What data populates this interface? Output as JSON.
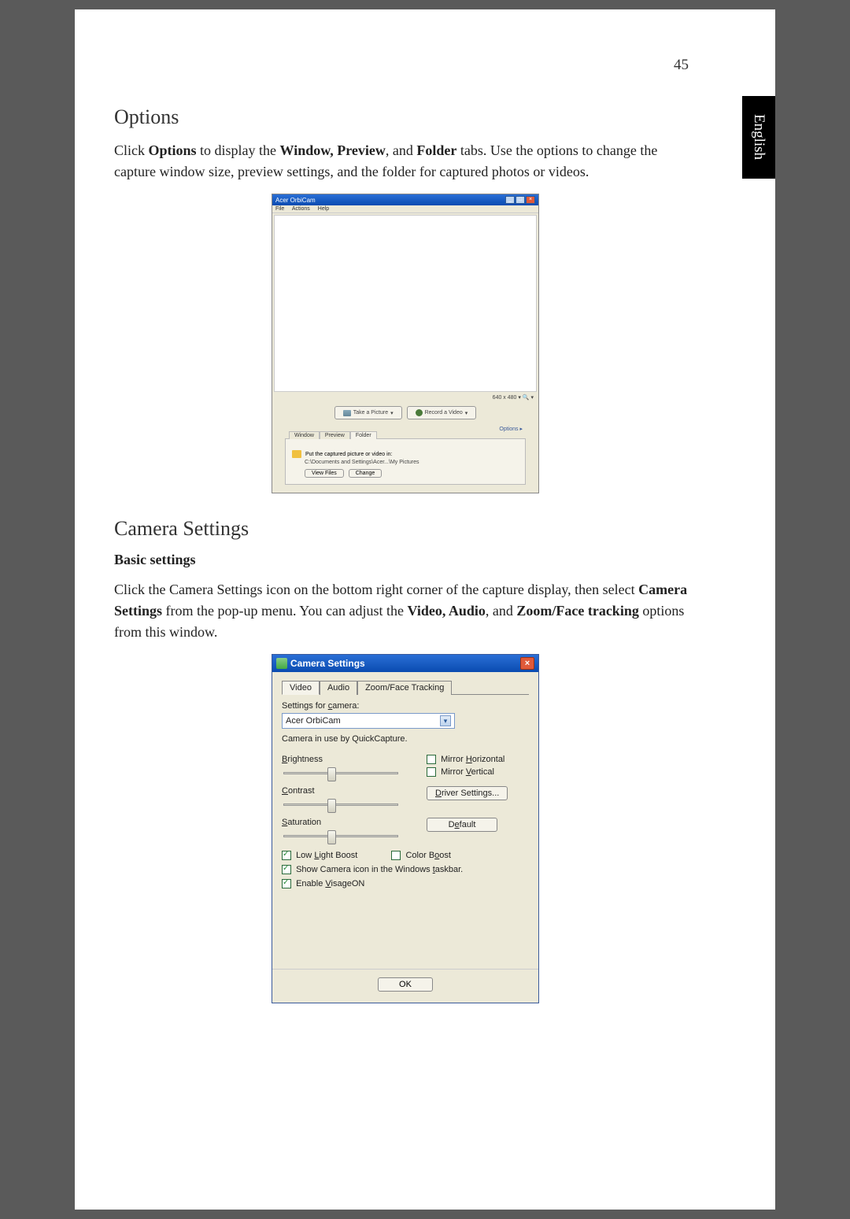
{
  "page_number": "45",
  "side_tab": "English",
  "sections": {
    "options": {
      "heading": "Options",
      "para_parts": {
        "t1": "Click ",
        "b1": "Options",
        "t2": " to display the ",
        "b2": "Window, Preview",
        "t3": ", and ",
        "b3": "Folder",
        "t4": " tabs. Use the options to change the capture window size, preview settings, and the folder for captured photos or videos."
      }
    },
    "camera_settings": {
      "heading": "Camera Settings",
      "sub_heading": "Basic settings",
      "para_parts": {
        "t1": "Click the Camera Settings icon on the bottom right corner of the capture display, then select ",
        "b1": "Camera Settings",
        "t2": " from the pop-up menu. You can adjust the ",
        "b2": "Video, Audio",
        "t3": ", and ",
        "b3": "Zoom/Face tracking",
        "t4": " options from this window."
      }
    }
  },
  "orbicam": {
    "title": "Acer OrbiCam",
    "menu": {
      "file": "File",
      "actions": "Actions",
      "help": "Help"
    },
    "status": "640 x 480 ▾   🔍 ▾",
    "take_picture": "Take a Picture",
    "record_video": "Record a Video",
    "options_link": "Options  ▸",
    "tabs": {
      "window": "Window",
      "preview": "Preview",
      "folder": "Folder"
    },
    "folder_text": "Put the captured picture or video in:",
    "folder_path": "C:\\Documents and Settings\\Acer...\\My Pictures",
    "view_files": "View Files",
    "change": "Change"
  },
  "camset": {
    "title": "Camera Settings",
    "tabs": {
      "video": "Video",
      "audio": "Audio",
      "zoom": "Zoom/Face Tracking"
    },
    "settings_for_camera": "Settings for camera:",
    "dropdown_value": "Acer OrbiCam",
    "status": "Camera in use by QuickCapture.",
    "sliders": {
      "brightness": "Brightness",
      "contrast": "Contrast",
      "saturation": "Saturation"
    },
    "mirror_h": "Mirror Horizontal",
    "mirror_v": "Mirror Vertical",
    "driver": "Driver Settings...",
    "default": "Default",
    "low_light": "Low Light Boost",
    "color_boost": "Color Boost",
    "show_icon": "Show Camera icon in the Windows taskbar.",
    "enable_visage": "Enable VisageON",
    "ok": "OK"
  }
}
